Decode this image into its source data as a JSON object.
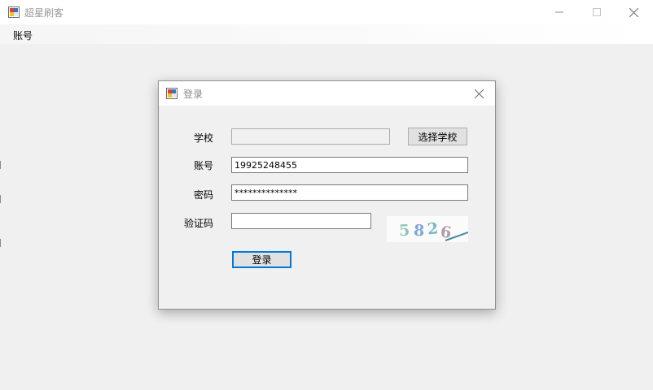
{
  "window": {
    "title": "超星刷客"
  },
  "menu": {
    "items": [
      "账号"
    ]
  },
  "dialog": {
    "title": "登录",
    "school": {
      "label": "学校",
      "value": "",
      "button": "选择学校"
    },
    "account": {
      "label": "账号",
      "value": "19925248455"
    },
    "password": {
      "label": "密码",
      "value": "**************"
    },
    "captcha": {
      "label": "验证码",
      "value": "",
      "image_text": "5826"
    },
    "login_button": "登录"
  },
  "colors": {
    "focus_accent": "#0078d7",
    "titlebar": "#ffffff",
    "client": "#f0f0f0"
  }
}
